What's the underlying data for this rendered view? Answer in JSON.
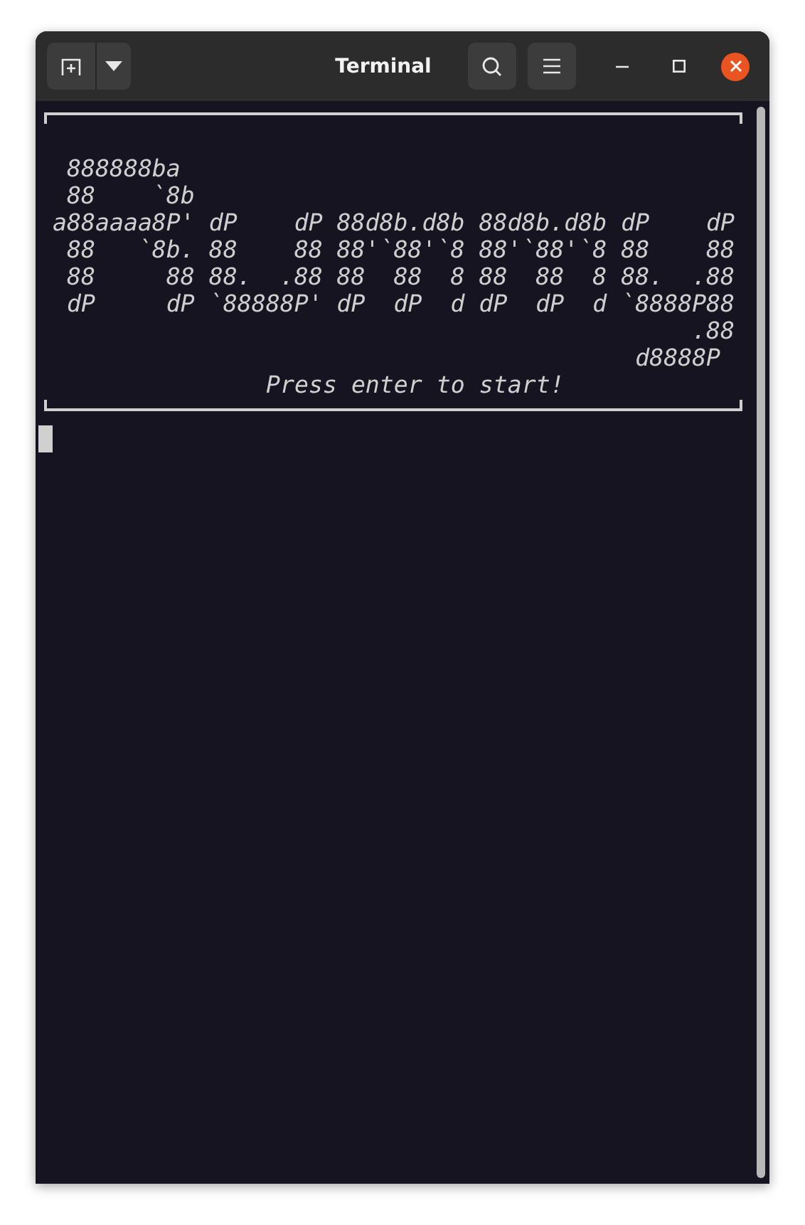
{
  "window": {
    "title": "Terminal"
  },
  "terminal": {
    "banner_lines": [
      " 888888ba",
      " 88    `8b",
      "a88aaaa8P' dP    dP 88d8b.d8b 88d8b.d8b dP    dP",
      " 88   `8b. 88    88 88'`88'`8 88'`88'`8 88    88",
      " 88     88 88.  .88 88  88  8 88  88  8 88.  .88",
      " dP     dP `88888P' dP  dP  d dP  dP  d `8888P88",
      "                                             .88",
      "                                         d8888P"
    ],
    "prompt": "Press enter to start!"
  }
}
